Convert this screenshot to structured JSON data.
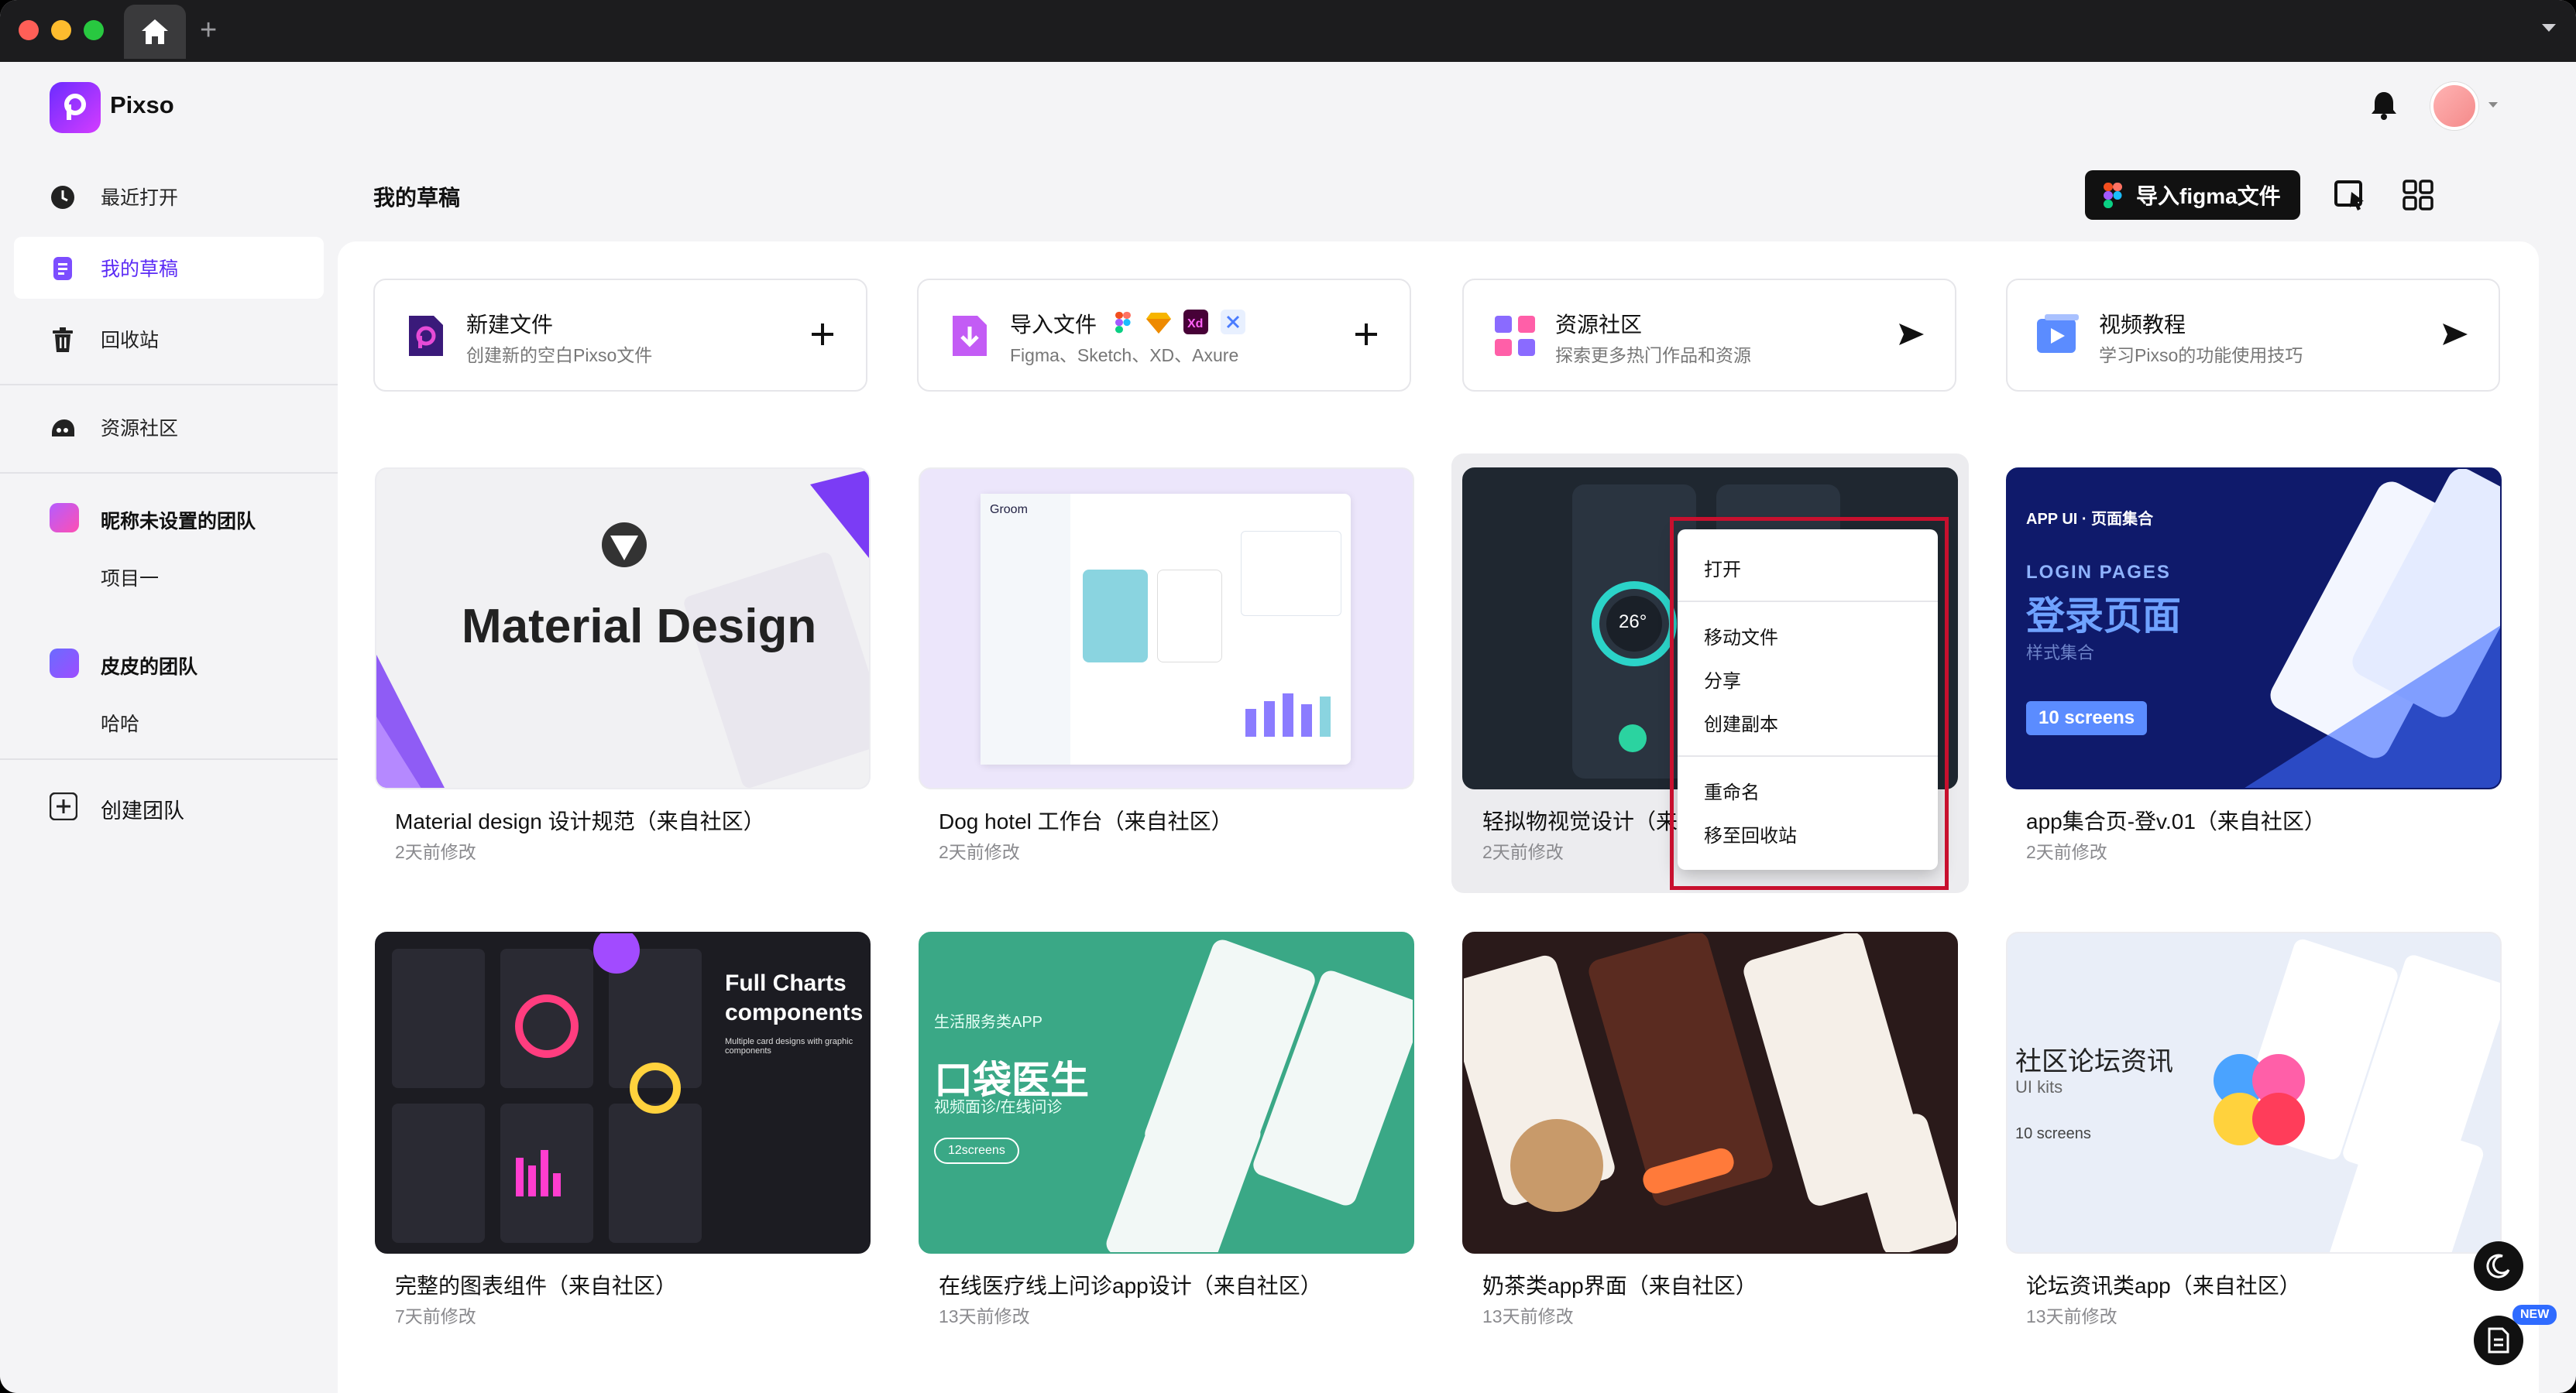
{
  "app": {
    "name": "Pixso"
  },
  "titlebar": {
    "tab_plus": "+"
  },
  "sidebar": {
    "items": [
      {
        "label": "最近打开"
      },
      {
        "label": "我的草稿"
      },
      {
        "label": "回收站"
      },
      {
        "label": "资源社区"
      }
    ],
    "teams": [
      {
        "name": "昵称未设置的团队",
        "projects": [
          "项目一"
        ]
      },
      {
        "name": "皮皮的团队",
        "projects": [
          "哈哈"
        ]
      }
    ],
    "create_team": "创建团队"
  },
  "header": {
    "title": "我的草稿",
    "import_figma": "导入figma文件"
  },
  "quick_actions": [
    {
      "title": "新建文件",
      "subtitle": "创建新的空白Pixso文件",
      "icon": "new-file-icon",
      "action": "plus-icon"
    },
    {
      "title": "导入文件",
      "subtitle": "Figma、Sketch、XD、Axure",
      "icon": "import-file-icon",
      "action": "plus-icon"
    },
    {
      "title": "资源社区",
      "subtitle": "探索更多热门作品和资源",
      "icon": "community-icon",
      "action": "send-icon"
    },
    {
      "title": "视频教程",
      "subtitle": "学习Pixso的功能使用技巧",
      "icon": "video-icon",
      "action": "send-icon"
    }
  ],
  "files": [
    {
      "name": "Material design 设计规范（来自社区）",
      "date": "2天前修改",
      "thumb_title": "Material Design"
    },
    {
      "name": "Dog hotel 工作台（来自社区）",
      "date": "2天前修改",
      "thumb_title": "Groom"
    },
    {
      "name": "轻拟物视觉设计（来自社区）",
      "date": "2天前修改",
      "thumb_title": "26°"
    },
    {
      "name": "app集合页-登v.01（来自社区）",
      "date": "2天前修改",
      "thumb_title": "登录页面",
      "thumb_eyebrow": "APP UI · 页面集合",
      "thumb_sub": "LOGIN PAGES",
      "thumb_note": "样式集合",
      "thumb_badge": "10 screens"
    },
    {
      "name": "完整的图表组件（来自社区）",
      "date": "7天前修改",
      "thumb_title": "Full Charts components",
      "thumb_sub": "Multiple card designs with graphic components"
    },
    {
      "name": "在线医疗线上问诊app设计（来自社区）",
      "date": "13天前修改",
      "thumb_title": "口袋医生",
      "thumb_eyebrow": "生活服务类APP",
      "thumb_sub": "视频面诊/在线问诊",
      "thumb_badge": "12screens"
    },
    {
      "name": "奶茶类app界面（来自社区）",
      "date": "13天前修改"
    },
    {
      "name": "论坛资讯类app（来自社区）",
      "date": "13天前修改",
      "thumb_title": "社区论坛资讯",
      "thumb_sub": "UI kits",
      "thumb_badge": "10 screens"
    }
  ],
  "context_menu": {
    "items": [
      "打开",
      "移动文件",
      "分享",
      "创建副本",
      "重命名",
      "移至回收站"
    ]
  },
  "fab": {
    "new_badge": "NEW"
  },
  "colors": {
    "accent": "#5b2bf5",
    "highlight_border": "#c8102e",
    "titlebar": "#1c1c1e"
  }
}
